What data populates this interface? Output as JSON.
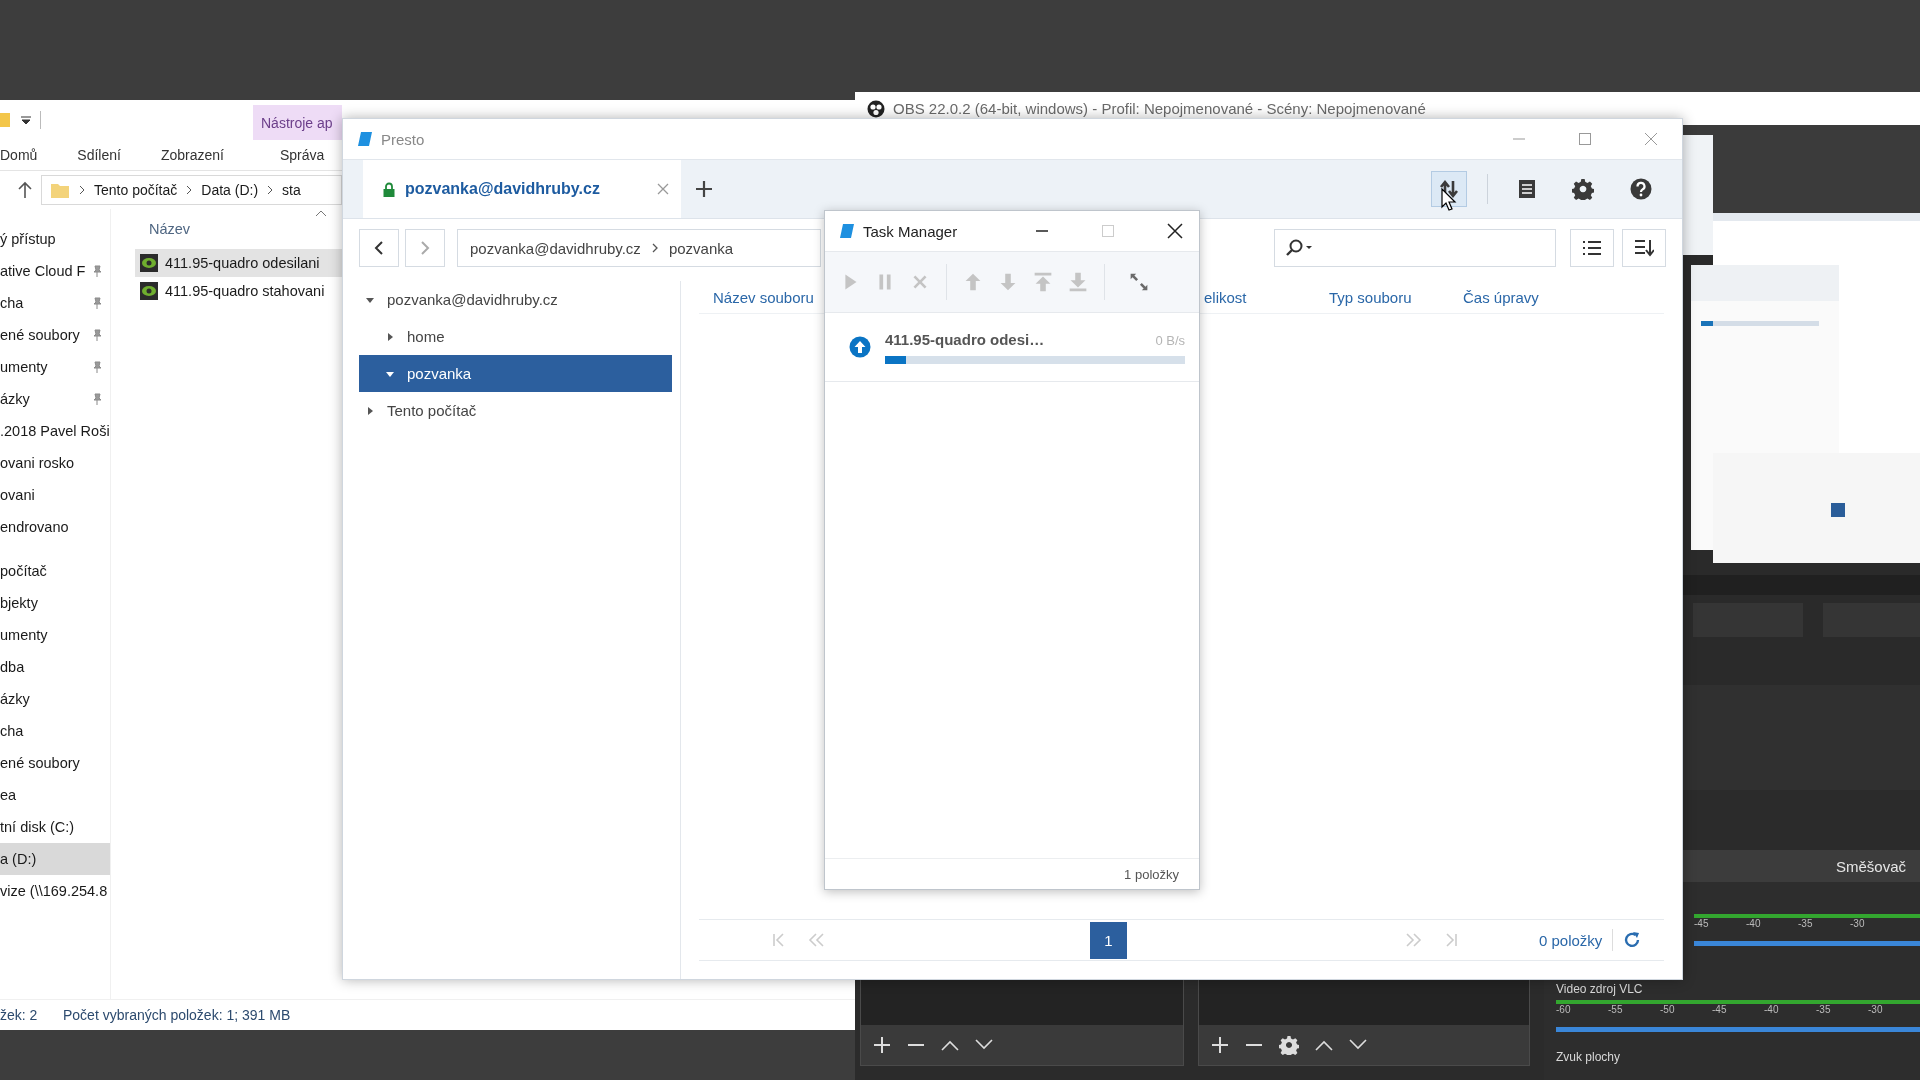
{
  "explorer": {
    "context_tab": "Nástroje ap",
    "ribbon_tabs": [
      "Domů",
      "Sdílení",
      "Zobrazení",
      "Správa"
    ],
    "address": [
      "Tento počítač",
      "Data (D:)",
      "sta"
    ],
    "nav_groups": [
      [
        {
          "label": "ý přístup",
          "pinned": false,
          "selected": false
        },
        {
          "label": "ative Cloud F",
          "pinned": true,
          "selected": false
        },
        {
          "label": "cha",
          "pinned": true,
          "selected": false
        },
        {
          "label": "ené soubory",
          "pinned": true,
          "selected": false
        },
        {
          "label": "umenty",
          "pinned": true,
          "selected": false
        },
        {
          "label": "ázky",
          "pinned": true,
          "selected": false
        },
        {
          "label": ".2018 Pavel Roši",
          "pinned": false,
          "selected": false
        },
        {
          "label": "ovani rosko",
          "pinned": false,
          "selected": false
        },
        {
          "label": "ovani",
          "pinned": false,
          "selected": false
        },
        {
          "label": "endrovano",
          "pinned": false,
          "selected": false
        }
      ],
      [
        {
          "label": "počítač",
          "pinned": false,
          "selected": false
        },
        {
          "label": "bjekty",
          "pinned": false,
          "selected": false
        },
        {
          "label": "umenty",
          "pinned": false,
          "selected": false
        },
        {
          "label": "dba",
          "pinned": false,
          "selected": false
        },
        {
          "label": "ázky",
          "pinned": false,
          "selected": false
        },
        {
          "label": "cha",
          "pinned": false,
          "selected": false
        },
        {
          "label": "ené soubory",
          "pinned": false,
          "selected": false
        },
        {
          "label": "ea",
          "pinned": false,
          "selected": false
        },
        {
          "label": "tní disk (C:)",
          "pinned": false,
          "selected": false
        },
        {
          "label": "a (D:)",
          "pinned": false,
          "selected": true
        },
        {
          "label": "vize (\\\\169.254.8",
          "pinned": false,
          "selected": false
        }
      ]
    ],
    "column": "Název",
    "files": [
      {
        "name": "411.95-quadro odesilani",
        "selected": true
      },
      {
        "name": "411.95-quadro stahovani",
        "selected": false
      }
    ],
    "status": [
      "žek: 2",
      "Počet vybraných položek: 1; 391 MB"
    ]
  },
  "obs": {
    "title": "OBS 22.0.2 (64-bit, windows) - Profil: Nepojmenované - Scény: Nepojmenované",
    "mixer": {
      "title": "Směšovač",
      "meters": [
        {
          "ticks": [
            "-45",
            "-40",
            "-35",
            "-30"
          ],
          "level": 1
        },
        {
          "label": "Video zdroj VLC",
          "ticks": [
            "-60",
            "-55",
            "-50",
            "-45",
            "-40",
            "-35",
            "-30"
          ],
          "level": 1
        },
        {
          "label": "Zvuk plochy"
        }
      ]
    }
  },
  "presto": {
    "title": "Presto",
    "tabs": [
      {
        "label": "pozvanka@davidhruby.cz",
        "selected": true
      }
    ],
    "breadcrumb": [
      "pozvanka@davidhruby.cz",
      "pozvanka"
    ],
    "tree": [
      {
        "label": "pozvanka@davidhruby.cz",
        "expanded": true,
        "selected": false,
        "children": [
          {
            "label": "home",
            "expanded": false,
            "selected": false
          },
          {
            "label": "pozvanka",
            "expanded": true,
            "selected": true
          }
        ]
      },
      {
        "label": "Tento počítač",
        "expanded": false,
        "selected": false
      }
    ],
    "columns": [
      "Název souboru",
      "elikost",
      "Typ souboru",
      "Čas úpravy"
    ],
    "pages": [
      {
        "label": "1",
        "selected": true
      }
    ],
    "count": "0 položky"
  },
  "task_manager": {
    "title": "Task Manager",
    "toolbar": [
      {
        "kind": "play",
        "disabled": true
      },
      {
        "kind": "pause",
        "disabled": true
      },
      {
        "kind": "stop",
        "disabled": true
      },
      {
        "kind": "separator"
      },
      {
        "kind": "up",
        "disabled": true
      },
      {
        "kind": "down",
        "disabled": true
      },
      {
        "kind": "top",
        "disabled": true
      },
      {
        "kind": "bottom",
        "disabled": true
      },
      {
        "kind": "separator"
      },
      {
        "kind": "collapse",
        "disabled": false
      }
    ],
    "tasks": [
      {
        "kind": "upload",
        "name": "411.95-quadro odesi…",
        "speed": "0 B/s",
        "level": 0.07
      }
    ],
    "footer": "1 položky"
  }
}
